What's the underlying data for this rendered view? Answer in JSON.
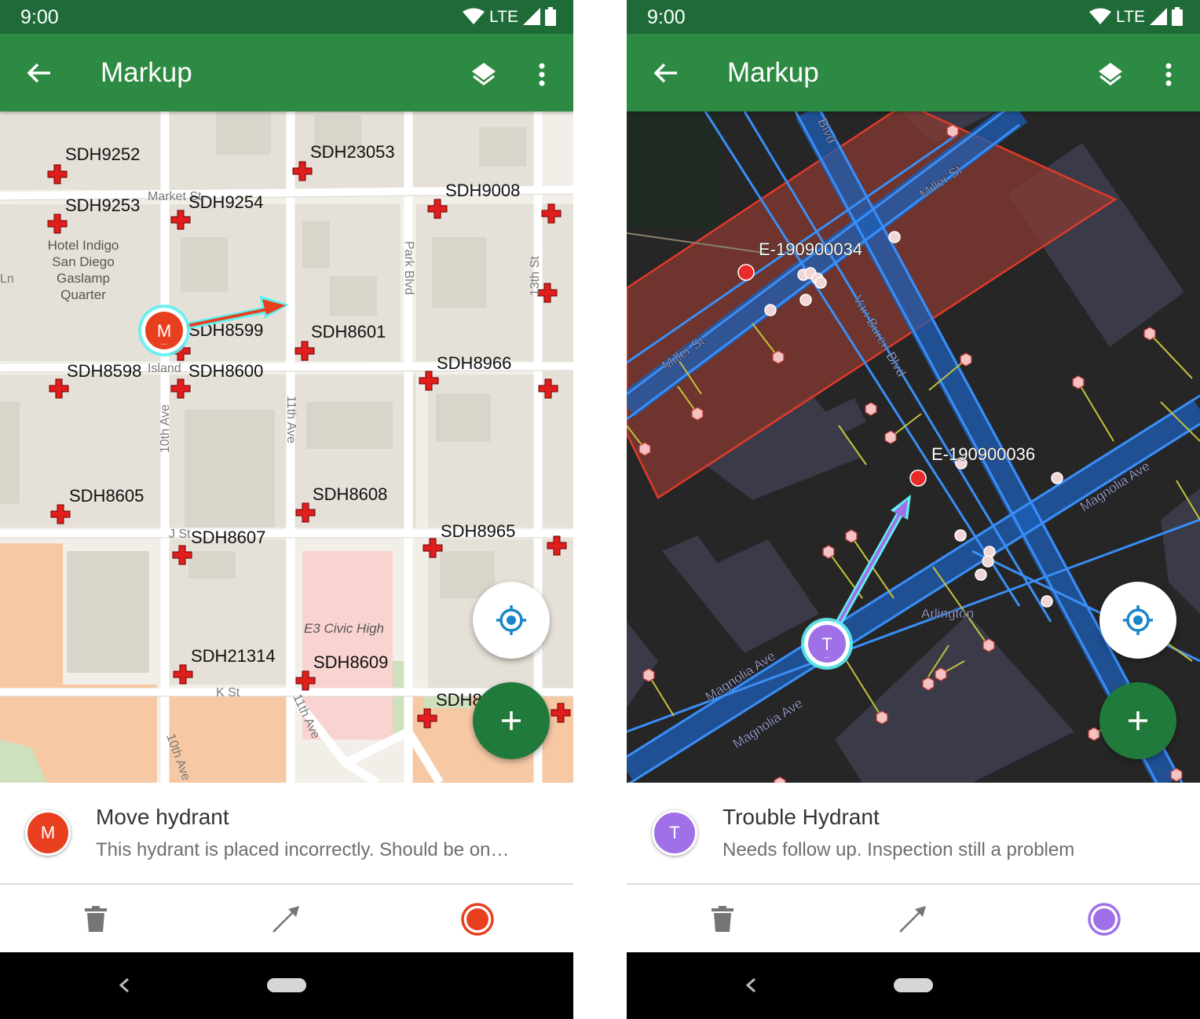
{
  "screens": [
    {
      "status": {
        "time": "9:00",
        "network": "LTE"
      },
      "app_bar": {
        "title": "Markup"
      },
      "map": {
        "hydrant_labels": [
          "SDH9252",
          "SDH23053",
          "SDH9253",
          "SDH9254",
          "SDH9008",
          "SDH8599",
          "SDH8601",
          "SDH8598",
          "SDH8600",
          "SDH8966",
          "SDH8605",
          "SDH8608",
          "SDH8607",
          "SDH8965",
          "SDH21314",
          "SDH8609",
          "SDH8"
        ],
        "street_labels": [
          "Market St",
          "Park Blvd",
          "13th St",
          "Island",
          "10th Ave",
          "11th Ave",
          "J St",
          "K St",
          "10th Ave",
          "11th Ave",
          "Ln"
        ],
        "poi_labels": [
          "Hotel Indigo",
          "San Diego",
          "Gaslamp",
          "Quarter",
          "E3 Civic High"
        ],
        "markup_initial": "M",
        "markup_color": "#e8401f"
      },
      "info": {
        "initial": "M",
        "title": "Move hydrant",
        "description": "This hydrant is placed incorrectly. Should be on…",
        "color": "#e8401f"
      }
    },
    {
      "status": {
        "time": "9:00",
        "network": "LTE"
      },
      "app_bar": {
        "title": "Markup"
      },
      "map": {
        "feature_labels": [
          "E-190900034",
          "E-190900036"
        ],
        "street_labels": [
          "Blvd",
          "Miller St",
          "Miller St",
          "Van Buren Blvd",
          "Magnolia Ave",
          "Arlington",
          "Magnolia Ave",
          "Magnolia Ave"
        ],
        "markup_initial": "T",
        "markup_color": "#a070e8"
      },
      "info": {
        "initial": "T",
        "title": "Trouble Hydrant",
        "description": "Needs follow up. Inspection still a problem",
        "color": "#a070e8"
      }
    }
  ]
}
